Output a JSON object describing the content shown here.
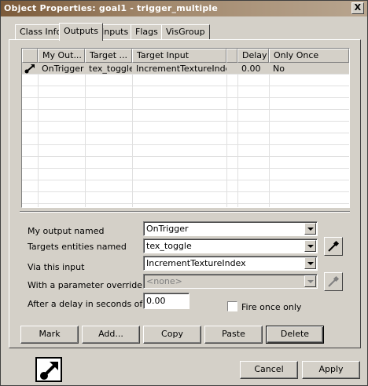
{
  "window": {
    "title": "Object Properties: goal1 - trigger_multiple",
    "close_label": "X"
  },
  "tabs": [
    {
      "label": "Class Info"
    },
    {
      "label": "Outputs"
    },
    {
      "label": "Inputs"
    },
    {
      "label": "Flags"
    },
    {
      "label": "VisGroup"
    }
  ],
  "outputs_table": {
    "columns": [
      "My Out...",
      "Target ...",
      "Target Input",
      "Delay",
      "Only Once"
    ],
    "rows": [
      {
        "icon": "output-connection-icon",
        "output": "OnTrigger",
        "target": "tex_toggle",
        "input": "IncrementTextureIndex",
        "delay": "0.00",
        "only_once": "No"
      }
    ]
  },
  "form": {
    "output_label": "My output named",
    "output_value": "OnTrigger",
    "targets_label": "Targets entities named",
    "targets_value": "tex_toggle",
    "input_label": "Via this input",
    "input_value": "IncrementTextureIndex",
    "param_label": "With a parameter override of",
    "param_value": "<none>",
    "delay_label": "After a delay in seconds of",
    "delay_value": "0.00",
    "fire_once_label": "Fire once only"
  },
  "buttons": {
    "mark": "Mark",
    "add": "Add...",
    "copy": "Copy",
    "paste": "Paste",
    "delete": "Delete",
    "cancel": "Cancel",
    "apply": "Apply"
  },
  "colors": {
    "dialog_bg": "#d4d0c8",
    "title_bar": "#7b5a39"
  }
}
